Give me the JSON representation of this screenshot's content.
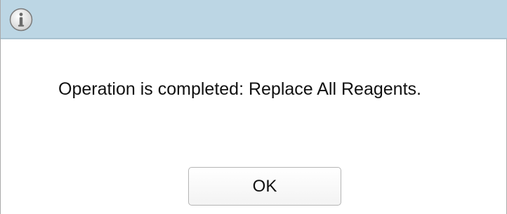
{
  "dialog": {
    "icon": "info-icon",
    "title": "",
    "message": "Operation is completed: Replace All Reagents.",
    "ok_label": "OK"
  },
  "colors": {
    "title_bar": "#bcd6e4",
    "background": "#ffffff",
    "text": "#111111"
  }
}
